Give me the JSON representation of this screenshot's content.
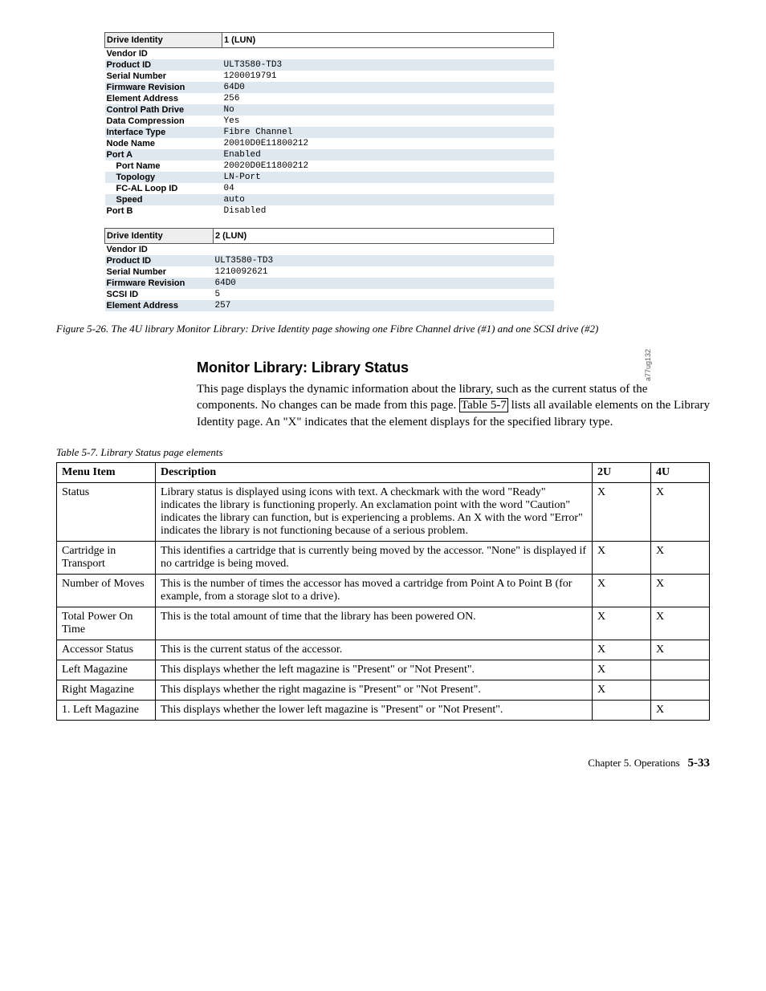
{
  "sideLabel": "a77ug132",
  "drive1": {
    "headerLabel": "Drive Identity",
    "headerValue": "1 (LUN)",
    "rows": [
      {
        "label": "Vendor ID",
        "value": ""
      },
      {
        "label": "Product ID",
        "value": "ULT3580-TD3"
      },
      {
        "label": "Serial Number",
        "value": "1200019791"
      },
      {
        "label": "Firmware Revision",
        "value": "64D0"
      },
      {
        "label": "Element Address",
        "value": "256"
      },
      {
        "label": "Control Path Drive",
        "value": "No"
      },
      {
        "label": "Data Compression",
        "value": "Yes"
      },
      {
        "label": "Interface Type",
        "value": "Fibre Channel"
      },
      {
        "label": "Node Name",
        "value": "20010D0E11800212"
      },
      {
        "label": "Port A",
        "value": "Enabled"
      },
      {
        "label": "Port Name",
        "value": "20020D0E11800212",
        "indent": true
      },
      {
        "label": "Topology",
        "value": "LN-Port",
        "indent": true
      },
      {
        "label": "FC-AL Loop ID",
        "value": "04",
        "indent": true
      },
      {
        "label": "Speed",
        "value": "auto",
        "indent": true
      },
      {
        "label": "Port B",
        "value": "Disabled"
      }
    ]
  },
  "drive2": {
    "headerLabel": "Drive Identity",
    "headerValue": "2 (LUN)",
    "rows": [
      {
        "label": "Vendor ID",
        "value": ""
      },
      {
        "label": "Product ID",
        "value": "ULT3580-TD3"
      },
      {
        "label": "Serial Number",
        "value": "1210092621"
      },
      {
        "label": "Firmware Revision",
        "value": "64D0"
      },
      {
        "label": "SCSI ID",
        "value": "5"
      },
      {
        "label": "Element Address",
        "value": "257"
      }
    ]
  },
  "figureCaption": "Figure 5-26. The 4U library Monitor Library: Drive Identity page showing one Fibre Channel drive (#1) and one SCSI drive (#2)",
  "sectionHeading": "Monitor Library: Library Status",
  "bodyText": {
    "part1": "This page displays the dynamic information about the library, such as the current status of the components. No changes can be made from this page. ",
    "link": "Table 5-7",
    "part2": " lists all available elements on the Library Identity page. An \"X\" indicates that the element displays for the specified library type."
  },
  "tableCaption": "Table 5-7. Library Status page elements",
  "tableHeaders": {
    "menu": "Menu Item",
    "desc": "Description",
    "u2": "2U",
    "u4": "4U"
  },
  "tableRows": [
    {
      "menu": "Status",
      "desc": "Library status is displayed using icons with text. A checkmark with the word \"Ready\" indicates the library is functioning properly. An exclamation point with the word \"Caution\" indicates the library can function, but is experiencing a problems. An X with the word \"Error\" indicates the library is not functioning because of a serious problem.",
      "u2": "X",
      "u4": "X"
    },
    {
      "menu": "Cartridge in Transport",
      "desc": "This identifies a cartridge that is currently being moved by the accessor. \"None\" is displayed if no cartridge is being moved.",
      "u2": "X",
      "u4": "X"
    },
    {
      "menu": "Number of Moves",
      "desc": "This is the number of times the accessor has moved a cartridge from Point A to Point B (for example, from a storage slot to a drive).",
      "u2": "X",
      "u4": "X"
    },
    {
      "menu": "Total Power On Time",
      "desc": "This is the total amount of time that the library has been powered ON.",
      "u2": "X",
      "u4": "X"
    },
    {
      "menu": "Accessor Status",
      "desc": "This is the current status of the accessor.",
      "u2": "X",
      "u4": "X"
    },
    {
      "menu": "Left Magazine",
      "desc": "This displays whether the left magazine is \"Present\" or \"Not Present\".",
      "u2": "X",
      "u4": ""
    },
    {
      "menu": "Right Magazine",
      "desc": "This displays whether the right magazine is \"Present\" or \"Not Present\".",
      "u2": "X",
      "u4": ""
    },
    {
      "menu": "1. Left Magazine",
      "desc": "This displays whether the lower left magazine is \"Present\" or \"Not Present\".",
      "u2": "",
      "u4": "X"
    }
  ],
  "footer": {
    "chapter": "Chapter 5. Operations",
    "page": "5-33"
  }
}
